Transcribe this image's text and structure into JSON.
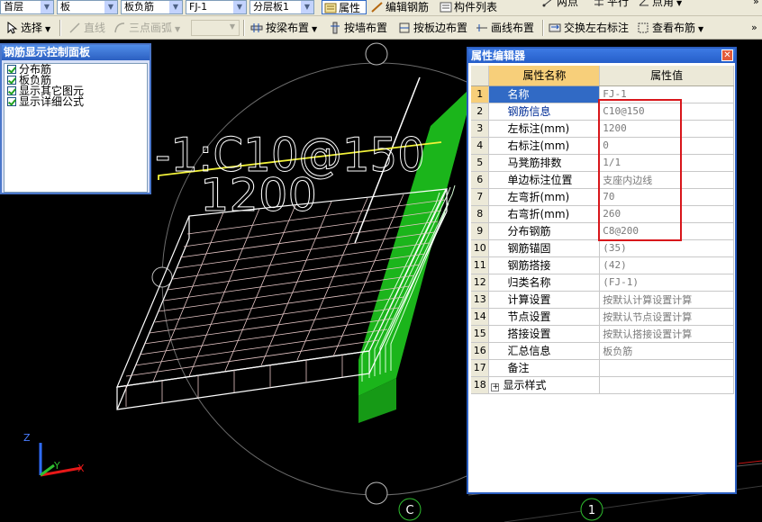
{
  "toolbar1": {
    "floor_combo": "首层",
    "component_combo": "板",
    "type_combo": "板负筋",
    "name_combo": "FJ-1",
    "layer_combo": "分层板1",
    "btn_properties": "属性",
    "btn_edit_rebar": "编辑钢筋",
    "btn_component_list": "构件列表",
    "btn_two_points": "两点",
    "btn_parallel": "平行",
    "btn_point_angle": "点角"
  },
  "toolbar2": {
    "select": "选择",
    "line": "直线",
    "arc": "三点画弧",
    "by_beam": "按梁布置",
    "by_wall": "按墙布置",
    "by_slab_edge": "按板边布置",
    "draw_line": "画线布置",
    "swap_labels": "交换左右标注",
    "view_layout": "查看布筋"
  },
  "control_panel": {
    "title": "钢筋显示控制面板",
    "items": [
      {
        "label": "分布筋",
        "checked": true
      },
      {
        "label": "板负筋",
        "checked": true
      },
      {
        "label": "显示其它图元",
        "checked": true
      },
      {
        "label": "显示详细公式",
        "checked": true
      }
    ]
  },
  "canvas": {
    "rebar_label_top": "-1:C10@150",
    "rebar_label_bottom": "1200",
    "axis_c": "C",
    "axis_1": "1",
    "axis_z": "Z",
    "axis_y": "Y",
    "axis_x": "X"
  },
  "property_editor": {
    "title": "属性编辑器",
    "header_name": "属性名称",
    "header_value": "属性值",
    "rows": [
      {
        "num": "1",
        "name": "名称",
        "value": "FJ-1"
      },
      {
        "num": "2",
        "name": "钢筋信息",
        "value": "C10@150"
      },
      {
        "num": "3",
        "name": "左标注(mm)",
        "value": "1200"
      },
      {
        "num": "4",
        "name": "右标注(mm)",
        "value": "0"
      },
      {
        "num": "5",
        "name": "马凳筋排数",
        "value": "1/1"
      },
      {
        "num": "6",
        "name": "单边标注位置",
        "value": "支座内边线"
      },
      {
        "num": "7",
        "name": "左弯折(mm)",
        "value": "70"
      },
      {
        "num": "8",
        "name": "右弯折(mm)",
        "value": "260"
      },
      {
        "num": "9",
        "name": "分布钢筋",
        "value": "C8@200"
      },
      {
        "num": "10",
        "name": "钢筋锚固",
        "value": "(35)"
      },
      {
        "num": "11",
        "name": "钢筋搭接",
        "value": "(42)"
      },
      {
        "num": "12",
        "name": "归类名称",
        "value": "(FJ-1)"
      },
      {
        "num": "13",
        "name": "计算设置",
        "value": "按默认计算设置计算"
      },
      {
        "num": "14",
        "name": "节点设置",
        "value": "按默认节点设置计算"
      },
      {
        "num": "15",
        "name": "搭接设置",
        "value": "按默认搭接设置计算"
      },
      {
        "num": "16",
        "name": "汇总信息",
        "value": "板负筋"
      },
      {
        "num": "17",
        "name": "备注",
        "value": ""
      },
      {
        "num": "18",
        "name": "显示样式",
        "value": ""
      }
    ]
  },
  "colors": {
    "canvas_bg": "#000000",
    "rebar_white": "#ffffff",
    "label_yellow": "#f2f23a",
    "wall_green": "#1bb51b",
    "highlight_red": "#d8161b",
    "selection_blue": "#316ac5"
  }
}
